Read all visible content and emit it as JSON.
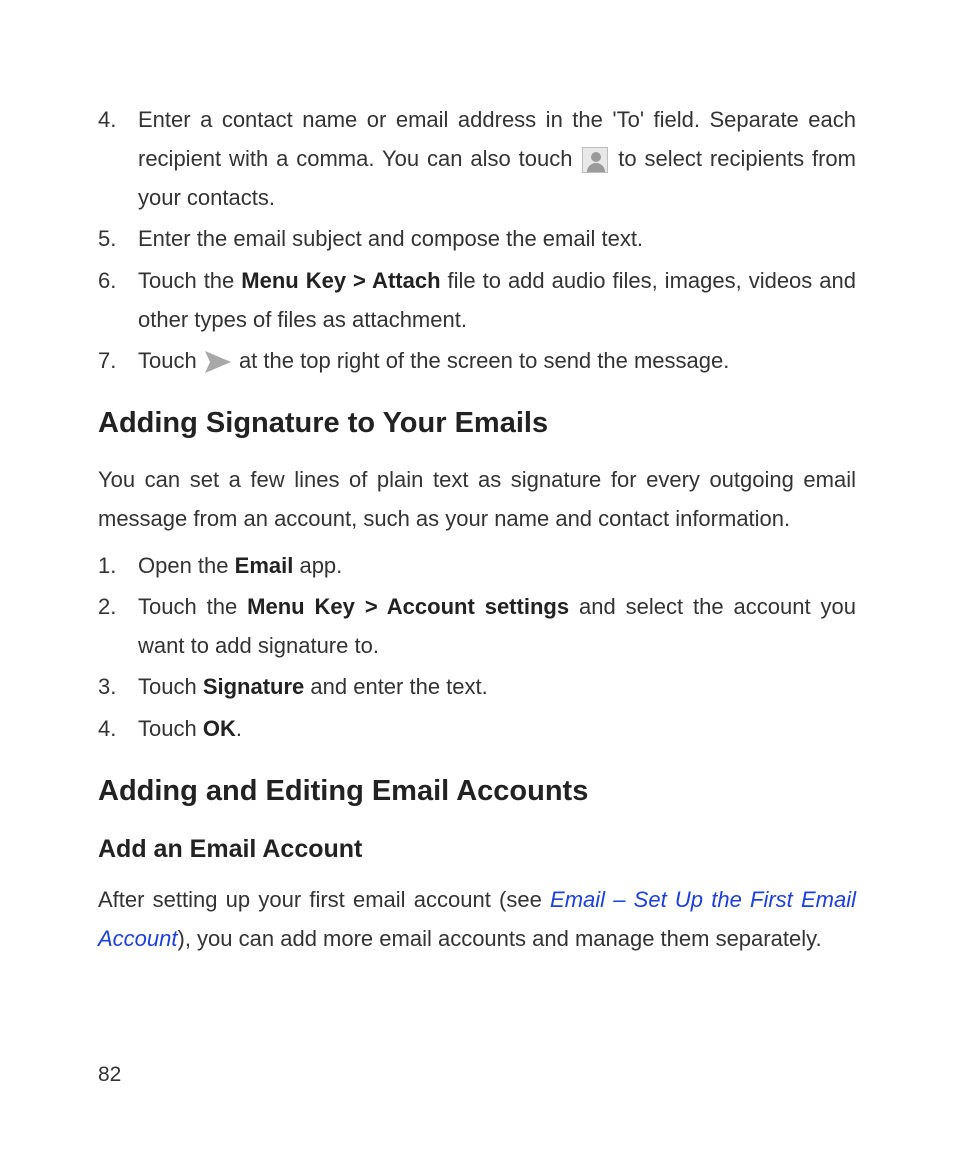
{
  "list1": {
    "item4": {
      "pre": "Enter a contact name or email address in the 'To' field. Sepa­rate each recipient with a comma. You can also touch ",
      "post": " to select recipients from your contacts."
    },
    "item5": "Enter the email subject and compose the email text.",
    "item6": {
      "pre": "Touch the ",
      "bold": "Menu Key > Attach",
      "post": " file to add audio files, images, videos and other types of files as attachment."
    },
    "item7": {
      "pre": "Touch ",
      "post": " at the top right of the screen to send the message."
    }
  },
  "h1a": "Adding Signature to Your Emails",
  "para1": "You can set a few lines of plain text as signature for every out­going email message from an account, such as your name and contact information.",
  "list2": {
    "item1": {
      "pre": "Open the ",
      "bold": "Email",
      "post": " app."
    },
    "item2": {
      "pre": "Touch the ",
      "bold": "Menu Key > Account settings",
      "post": " and select the ac­count you want to add signature to."
    },
    "item3": {
      "pre": "Touch ",
      "bold": "Signature",
      "post": " and enter the text."
    },
    "item4": {
      "pre": "Touch ",
      "bold": "OK",
      "post": "."
    }
  },
  "h1b": "Adding and Editing Email Accounts",
  "h2a": "Add an Email Account",
  "para2": {
    "pre": "After setting up your first email account (see ",
    "link": "Email – Set Up the First Email Account",
    "post": "), you can add more email accounts and manage them separately."
  },
  "pageNum": "82"
}
